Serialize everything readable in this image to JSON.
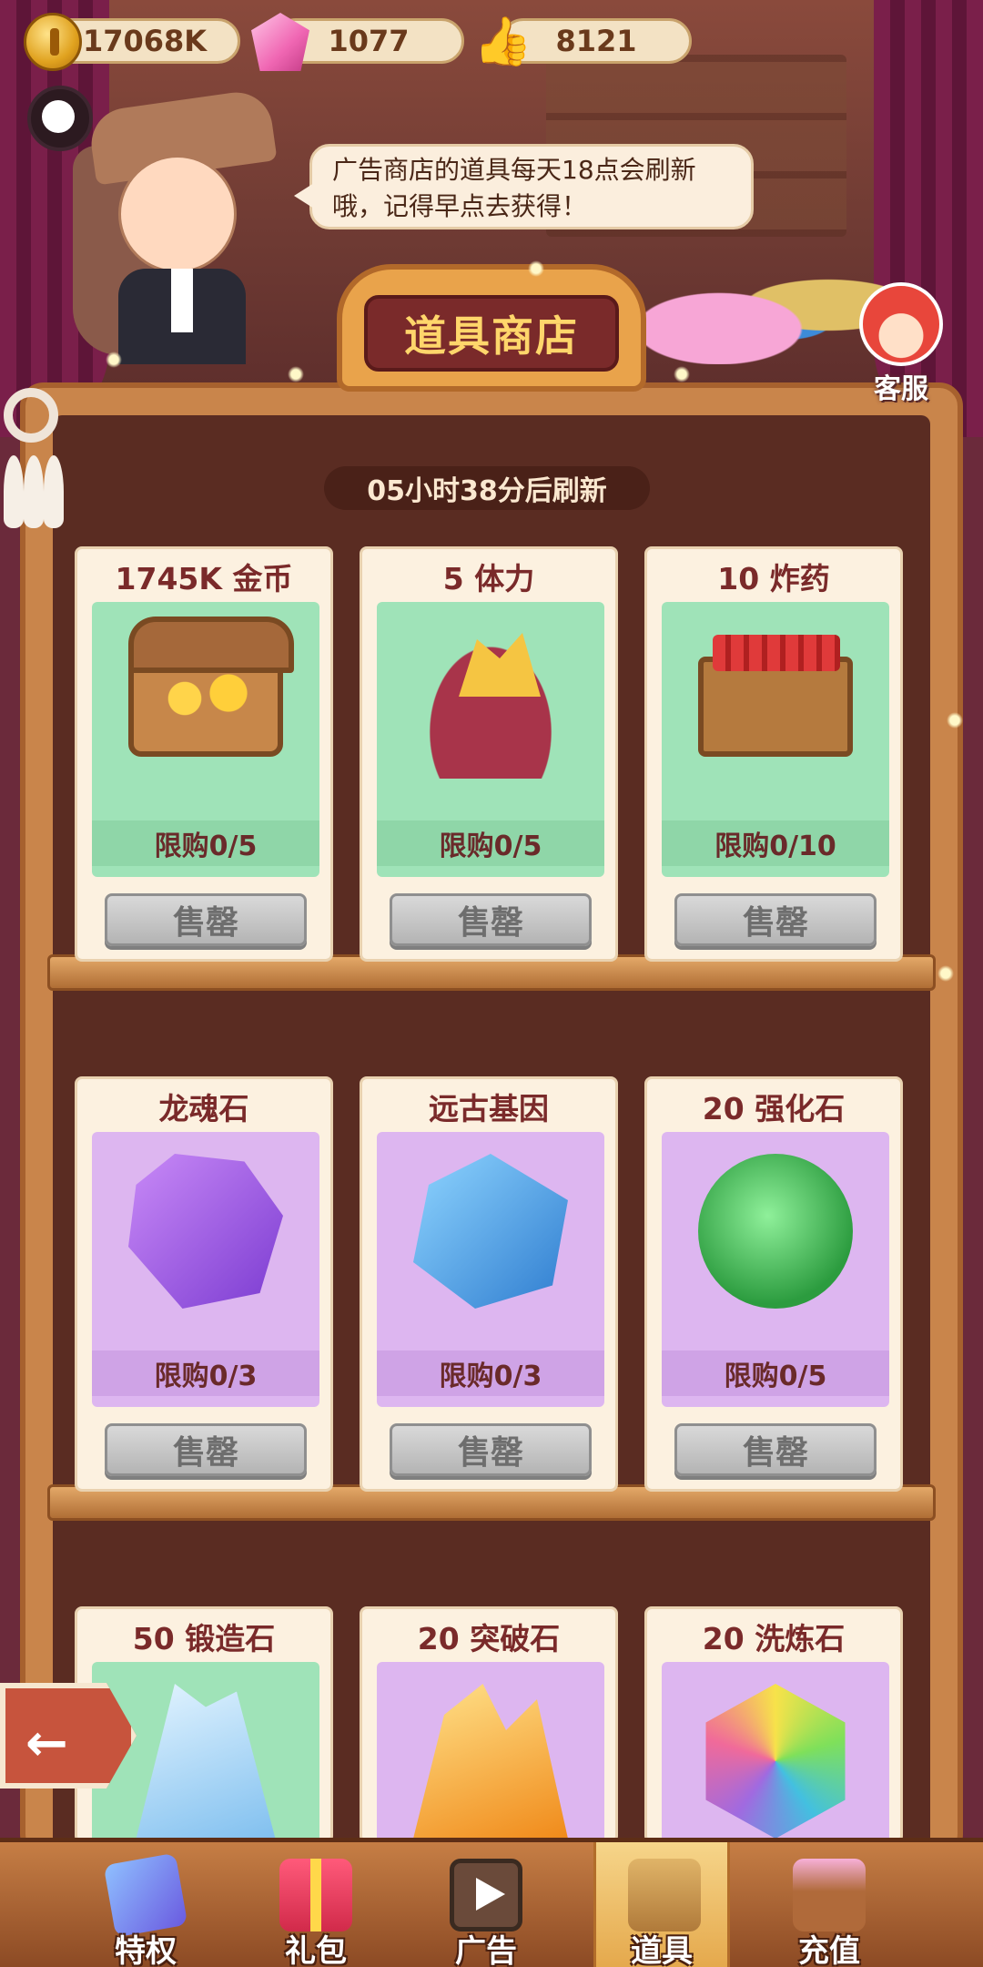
{
  "resources": {
    "coins": "17068K",
    "gems": "1077",
    "likes": "8121"
  },
  "npc": {
    "speech": "广告商店的道具每天18点会刷新哦，记得早点去获得！"
  },
  "shop": {
    "title": "道具商店",
    "customer_service_label": "客服",
    "refresh_timer": "05小时38分后刷新"
  },
  "items": [
    {
      "name": "1745K 金币",
      "limit": "限购0/5",
      "button": "售罄",
      "panel": "green",
      "art": "treasure-chest-icon"
    },
    {
      "name": "5 体力",
      "limit": "限购0/5",
      "button": "售罄",
      "panel": "green",
      "art": "energy-sack-icon"
    },
    {
      "name": "10 炸药",
      "limit": "限购0/10",
      "button": "售罄",
      "panel": "green",
      "art": "dynamite-crate-icon"
    },
    {
      "name": "龙魂石",
      "limit": "限购0/3",
      "button": "售罄",
      "panel": "purple",
      "art": "dragon-soul-stone-icon"
    },
    {
      "name": "远古基因",
      "limit": "限购0/3",
      "button": "售罄",
      "panel": "purple",
      "art": "ancient-gene-icon"
    },
    {
      "name": "20 强化石",
      "limit": "限购0/5",
      "button": "售罄",
      "panel": "purple",
      "art": "enhance-stone-icon"
    },
    {
      "name": "50 锻造石",
      "panel": "green",
      "art": "forge-crystal-icon"
    },
    {
      "name": "20 突破石",
      "panel": "purple",
      "art": "breakthrough-crystal-icon"
    },
    {
      "name": "20 洗炼石",
      "panel": "purple",
      "art": "refine-gem-icon"
    }
  ],
  "nav": [
    {
      "label": "特权",
      "icon": "privilege-cards-icon",
      "active": false
    },
    {
      "label": "礼包",
      "icon": "gift-box-icon",
      "active": false
    },
    {
      "label": "广告",
      "icon": "ad-tv-icon",
      "active": false
    },
    {
      "label": "道具",
      "icon": "items-box-icon",
      "active": true
    },
    {
      "label": "充值",
      "icon": "recharge-crate-icon",
      "active": false
    }
  ],
  "colors": {
    "green_panel": "#9fe3b8",
    "purple_panel": "#ddb6f0",
    "title_text": "#ffd66b",
    "item_name": "#7a2a2a"
  }
}
